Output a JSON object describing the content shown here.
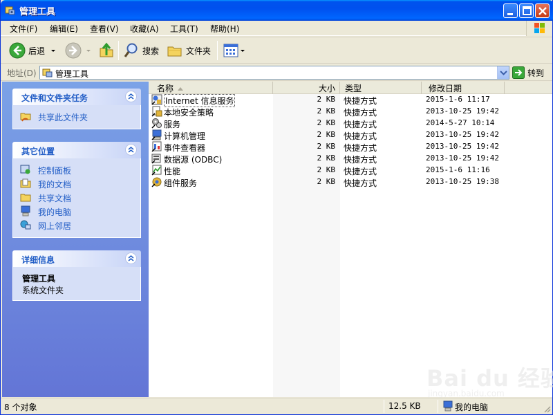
{
  "window": {
    "title": "管理工具"
  },
  "menu": [
    {
      "label": "文件(F)"
    },
    {
      "label": "编辑(E)"
    },
    {
      "label": "查看(V)"
    },
    {
      "label": "收藏(A)"
    },
    {
      "label": "工具(T)"
    },
    {
      "label": "帮助(H)"
    }
  ],
  "toolbar": {
    "back": "后退",
    "search": "搜索",
    "folders": "文件夹"
  },
  "address": {
    "label": "地址(D)",
    "value": "管理工具",
    "go": "转到"
  },
  "tasks": {
    "file_tasks": {
      "title": "文件和文件夹任务",
      "items": [
        "共享此文件夹"
      ]
    },
    "other_places": {
      "title": "其它位置",
      "items": [
        "控制面板",
        "我的文档",
        "共享文档",
        "我的电脑",
        "网上邻居"
      ]
    },
    "details": {
      "title": "详细信息",
      "name": "管理工具",
      "desc": "系统文件夹"
    }
  },
  "columns": {
    "name": "名称",
    "size": "大小",
    "type": "类型",
    "modified": "修改日期"
  },
  "files": [
    {
      "name": "Internet 信息服务",
      "size": "2 KB",
      "type": "快捷方式",
      "date": "2015-1-6 11:17"
    },
    {
      "name": "本地安全策略",
      "size": "2 KB",
      "type": "快捷方式",
      "date": "2013-10-25 19:42"
    },
    {
      "name": "服务",
      "size": "2 KB",
      "type": "快捷方式",
      "date": "2014-5-27 10:14"
    },
    {
      "name": "计算机管理",
      "size": "2 KB",
      "type": "快捷方式",
      "date": "2013-10-25 19:42"
    },
    {
      "name": "事件查看器",
      "size": "2 KB",
      "type": "快捷方式",
      "date": "2013-10-25 19:42"
    },
    {
      "name": "数据源 (ODBC)",
      "size": "2 KB",
      "type": "快捷方式",
      "date": "2013-10-25 19:42"
    },
    {
      "name": "性能",
      "size": "2 KB",
      "type": "快捷方式",
      "date": "2015-1-6 11:16"
    },
    {
      "name": "组件服务",
      "size": "2 KB",
      "type": "快捷方式",
      "date": "2013-10-25 19:38"
    }
  ],
  "status": {
    "count": "8 个对象",
    "size": "12.5 KB",
    "location": "我的电脑"
  },
  "watermark": {
    "text": "Bai du 经验",
    "sub": "jingyan.baidu.com"
  }
}
